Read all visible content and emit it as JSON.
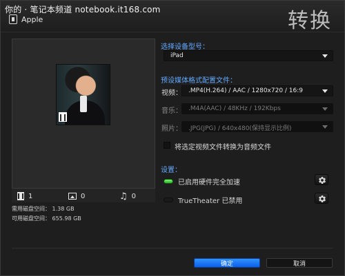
{
  "watermark": "你的 · 笔记本频道 notebook.it168.com",
  "header": {
    "title": "转换",
    "device": "Apple"
  },
  "preview": {
    "counts": {
      "video": "1",
      "photo": "0",
      "music": "0"
    },
    "disk": {
      "required_label": "需用磁盘空间：",
      "required_value": "1.38 GB",
      "available_label": "可用磁盘空间：",
      "available_value": "655.98 GB"
    }
  },
  "device_section": {
    "title": "选择设备型号：",
    "model": "iPad"
  },
  "profile_section": {
    "title": "预设媒体格式配置文件：",
    "video_label": "视频：",
    "video_value": ".MP4(H.264) / AAC / 1280x720 / 16:9",
    "audio_label": "音乐：",
    "audio_value": ".M4A(AAC) / 48KHz / 192Kbps",
    "photo_label": "照片：",
    "photo_value": ".JPG(JPG) / 640x480(保持显示比例)",
    "convert_checkbox_label": "将选定视频文件转换为音频文件"
  },
  "settings_section": {
    "title": "设置：",
    "hw_accel_label": "已启用硬件完全加速",
    "trutheater_label": "TrueTheater 已禁用"
  },
  "buttons": {
    "ok": "确定",
    "cancel": "取消"
  },
  "colors": {
    "accent_blue": "#63A9FF",
    "primary_button": "#1E7BFF",
    "led_green": "#2EAA2D"
  }
}
